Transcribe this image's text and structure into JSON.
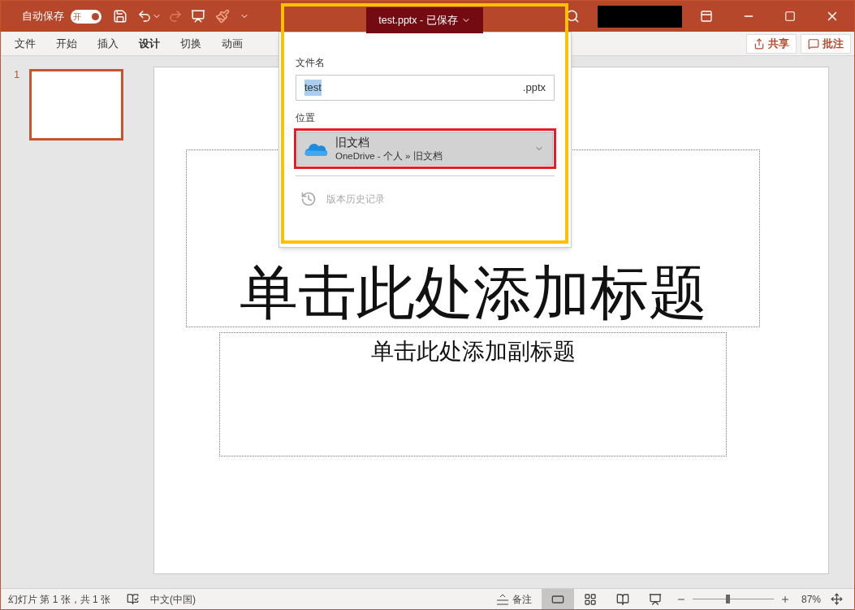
{
  "title_bar": {
    "autosave_label": "自动保存",
    "autosave_toggle": {
      "label": "开",
      "on": true
    },
    "document_title": "test.pptx - 已保存"
  },
  "ribbon_tabs": [
    {
      "label": "文件",
      "selected": false
    },
    {
      "label": "开始",
      "selected": false
    },
    {
      "label": "插入",
      "selected": false
    },
    {
      "label": "设计",
      "selected": true
    },
    {
      "label": "切换",
      "selected": false
    },
    {
      "label": "动画",
      "selected": false
    }
  ],
  "share_button": "共享",
  "comments_button": "批注",
  "thumbnails": [
    {
      "number": "1",
      "selected": true
    }
  ],
  "slide": {
    "title_placeholder": "单击此处添加标题",
    "subtitle_placeholder": "单击此处添加副标题"
  },
  "save_panel": {
    "filename_label": "文件名",
    "filename": "test",
    "extension": ".pptx",
    "location_label": "位置",
    "location": {
      "name": "旧文档",
      "path": "OneDrive - 个人 » 旧文档"
    },
    "version_history": {
      "label": "版本历史记录",
      "disabled": true
    }
  },
  "status_bar": {
    "slide_info": "幻灯片 第 1 张，共 1 张",
    "language": "中文(中国)",
    "notes": "备注",
    "views": [
      {
        "kind": "normal",
        "selected": true
      },
      {
        "kind": "sorter",
        "selected": false
      },
      {
        "kind": "reading",
        "selected": false
      },
      {
        "kind": "slideshow",
        "selected": false
      }
    ],
    "zoom": {
      "level": 0.43,
      "reading": "87%"
    }
  }
}
